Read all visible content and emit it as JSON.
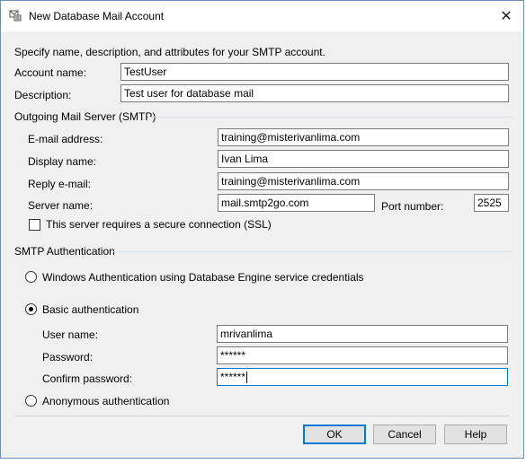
{
  "window": {
    "title": "New Database Mail Account",
    "close_glyph": "✕"
  },
  "intro": "Specify name, description, and attributes for your SMTP account.",
  "account": {
    "name_label": "Account name:",
    "name_value": "TestUser",
    "description_label": "Description:",
    "description_value": "Test user for database mail"
  },
  "smtp_server": {
    "group_label": "Outgoing Mail Server (SMTP)",
    "email_label": "E-mail address:",
    "email_value": "training@misterivanlima.com",
    "display_label": "Display name:",
    "display_value": "Ivan Lima",
    "reply_label": "Reply e-mail:",
    "reply_value": "training@misterivanlima.com",
    "server_label": "Server name:",
    "server_value": "mail.smtp2go.com",
    "port_label": "Port number:",
    "port_value": "2525",
    "ssl_label": "This server requires a secure connection (SSL)",
    "ssl_checked": false
  },
  "auth": {
    "group_label": "SMTP Authentication",
    "windows_label": "Windows Authentication using Database Engine service credentials",
    "basic_label": "Basic authentication",
    "selected": "basic",
    "username_label": "User name:",
    "username_value": "mrivanlima",
    "password_label": "Password:",
    "password_value": "******",
    "confirm_label": "Confirm password:",
    "confirm_value": "******",
    "anonymous_label": "Anonymous authentication"
  },
  "buttons": {
    "ok": "OK",
    "cancel": "Cancel",
    "help": "Help"
  },
  "colors": {
    "accent": "#0078d7",
    "dialog_bg": "#f0f0f0"
  }
}
